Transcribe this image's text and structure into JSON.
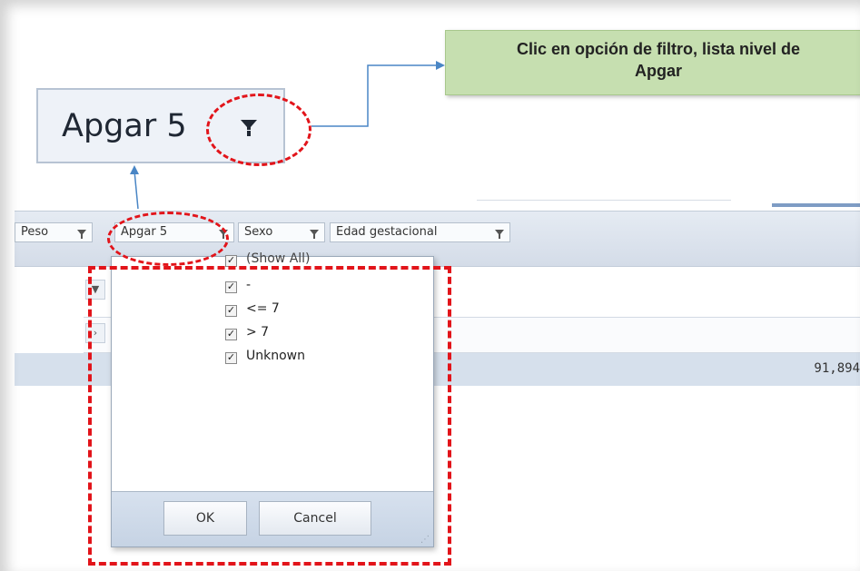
{
  "callout": {
    "line1": "Clic en opción de filtro, lista nivel de",
    "line2": "Apgar"
  },
  "zoom": {
    "label": "Apgar 5",
    "icon": "filter-icon"
  },
  "toolbar": {
    "fields": [
      {
        "label": "Peso",
        "icon": "filter-icon"
      },
      {
        "label": "Apgar 5",
        "icon": "filter-icon"
      },
      {
        "label": "Sexo",
        "icon": "filter-icon"
      },
      {
        "label": "Edad gestacional",
        "icon": "filter-icon"
      }
    ]
  },
  "filter_popup": {
    "options": [
      {
        "label": "(Show All)",
        "checked": true
      },
      {
        "label": "-",
        "checked": true
      },
      {
        "label": "<= 7",
        "checked": true
      },
      {
        "label": "> 7",
        "checked": true
      },
      {
        "label": "Unknown",
        "checked": true
      }
    ],
    "ok_label": "OK",
    "cancel_label": "Cancel"
  },
  "grid": {
    "expand_icon": "chevron-down-icon",
    "collapse_icon": "chevron-right-icon",
    "grand_total": "91,894"
  },
  "colors": {
    "highlight_red": "#e2141a",
    "callout_green": "#c6dfb0",
    "connector_blue": "#4a86c5"
  }
}
